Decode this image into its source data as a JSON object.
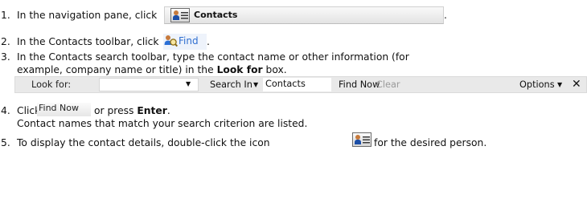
{
  "steps": [
    {
      "num": "1.",
      "text_before": "In the navigation pane, click",
      "text_after": "."
    },
    {
      "num": "2.",
      "text_before": "In the Contacts toolbar, click",
      "text_after": "."
    },
    {
      "num": "3.",
      "line1": "In the Contacts search toolbar, type the contact name or other information (for",
      "line2_before": "example, company name or title) in the ",
      "line2_bold": "Look for",
      "line2_after": " box."
    },
    {
      "num": "4.",
      "text_before": "Click",
      "text_mid": "or press",
      "text_bold": "Enter",
      "text_after": ".",
      "line2": "Contact names that match your search criterion are listed."
    },
    {
      "num": "5.",
      "text_before": "To display the contact details, double-click the icon",
      "text_after": "for the desired person."
    }
  ],
  "nav_button": {
    "label": "Contacts",
    "icon": "contact-card-icon"
  },
  "find_button": {
    "label": "Find",
    "icon": "find-contact-icon"
  },
  "search_toolbar": {
    "look_for_label": "Look for:",
    "look_for_value": "",
    "search_in_label": "Search In",
    "scope_value": "Contacts",
    "find_now": "Find Now",
    "clear": "Clear",
    "options": "Options",
    "close": "✕",
    "caret": "▼"
  },
  "find_now_button": {
    "label": "Find Now"
  },
  "colors": {
    "find_text": "#2f6fd0",
    "toolbar_bg": "#e9e9e9",
    "disabled_text": "#9a9a9a"
  }
}
